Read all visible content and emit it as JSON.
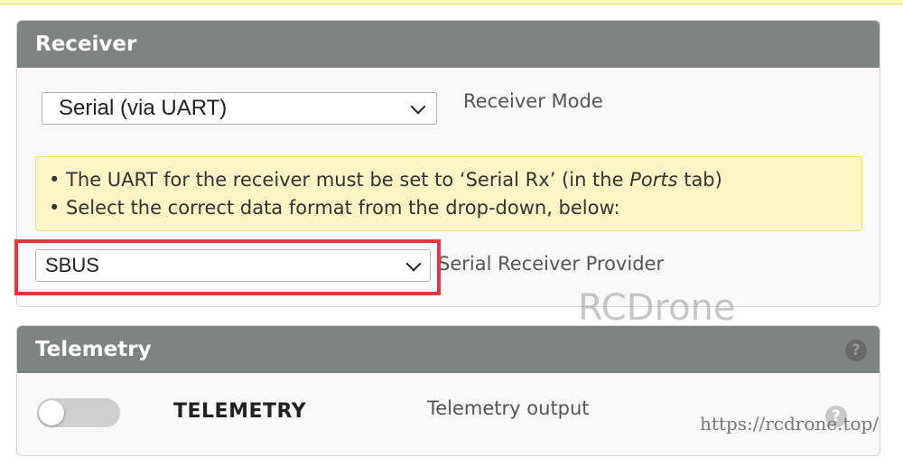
{
  "receiver": {
    "title": "Receiver",
    "mode_select": {
      "value": "Serial (via UART)"
    },
    "mode_label": "Receiver Mode",
    "notes": {
      "line1_a": "• The UART for the receiver must be set to ‘Serial Rx’ (in the ",
      "line1_em": "Ports",
      "line1_b": " tab)",
      "line2": "• Select the correct data format from the drop-down, below:"
    },
    "provider_select": {
      "value": "SBUS"
    },
    "provider_label": "Serial Receiver Provider"
  },
  "telemetry": {
    "title": "Telemetry",
    "help_glyph": "?",
    "toggle_state": false,
    "name": "TELEMETRY",
    "description": "Telemetry output",
    "help_glyph_2": "?"
  },
  "watermark": {
    "text": "RCDrone",
    "url": "https://rcdrone.top/"
  },
  "colors": {
    "header": "#7f8381",
    "note_bg": "#fcf6c5",
    "highlight": "#e8343f"
  }
}
